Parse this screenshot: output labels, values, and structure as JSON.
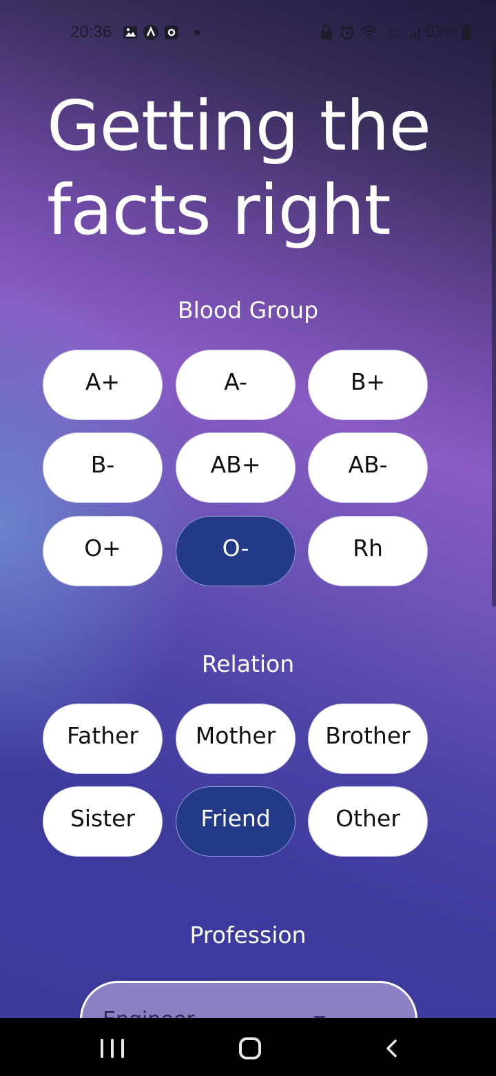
{
  "status_bar": {
    "time": "20:36",
    "battery": "93%",
    "left_icons": [
      "gallery-icon",
      "app-icon",
      "app-square-icon"
    ],
    "right_icons": [
      "lock-icon",
      "alarm-icon",
      "wifi-icon",
      "volte-icon",
      "signal-icon",
      "battery-icon"
    ]
  },
  "title": {
    "line1": "Getting the",
    "line2": "facts right"
  },
  "blood_group": {
    "label": "Blood Group",
    "options": [
      "A+",
      "A-",
      "B+",
      "B-",
      "AB+",
      "AB-",
      "O+",
      "O-",
      "Rh"
    ],
    "selected": "O-"
  },
  "relation": {
    "label": "Relation",
    "options": [
      "Father",
      "Mother",
      "Brother",
      "Sister",
      "Friend",
      "Other"
    ],
    "selected": "Friend"
  },
  "profession": {
    "label": "Profession",
    "value": "Engineer"
  },
  "colors": {
    "selected_chip": "#233a88",
    "chip": "#ffffff"
  }
}
